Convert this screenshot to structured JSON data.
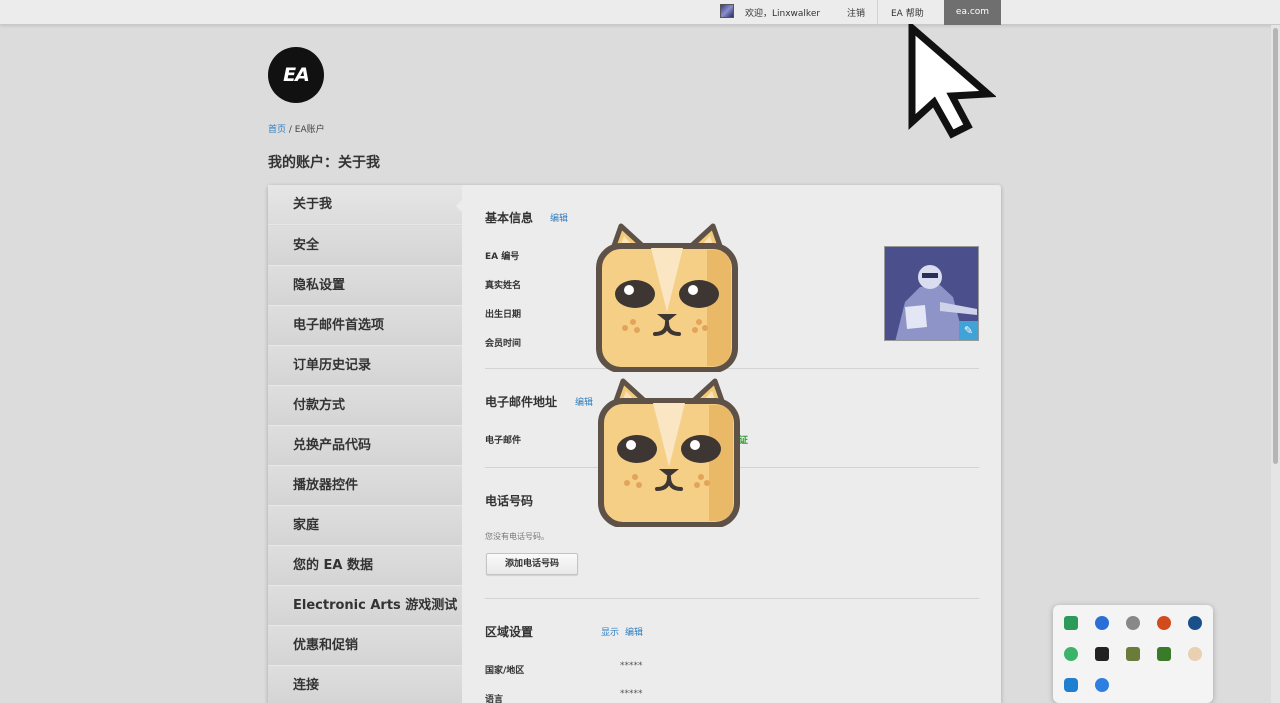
{
  "topbar": {
    "welcome": "欢迎，Linxwalker",
    "logout": "注销",
    "help": "EA 帮助",
    "site": "ea.com"
  },
  "logo_text": "EA",
  "breadcrumb": {
    "home": "首页",
    "separator": " / ",
    "current": "EA账户"
  },
  "page_title": "我的账户：关于我",
  "sidenav": {
    "items": [
      {
        "label": "关于我"
      },
      {
        "label": "安全"
      },
      {
        "label": "隐私设置"
      },
      {
        "label": "电子邮件首选项"
      },
      {
        "label": "订单历史记录"
      },
      {
        "label": "付款方式"
      },
      {
        "label": "兑换产品代码"
      },
      {
        "label": "播放器控件"
      },
      {
        "label": "家庭"
      },
      {
        "label": "您的 EA 数据"
      },
      {
        "label": "Electronic Arts 游戏测试"
      },
      {
        "label": "优惠和促销"
      },
      {
        "label": "连接"
      }
    ]
  },
  "basic_info": {
    "title": "基本信息",
    "edit": "编辑",
    "fields": [
      "EA 编号",
      "真实姓名",
      "出生日期",
      "会员时间"
    ]
  },
  "email": {
    "title": "电子邮件地址",
    "edit": "编辑",
    "label": "电子邮件",
    "status": "证"
  },
  "phone": {
    "title": "电话号码",
    "none_text": "您没有电话号码。",
    "add_button": "添加电话号码"
  },
  "region": {
    "title": "区域设置",
    "show": "显示",
    "edit": "编辑",
    "fields": [
      {
        "label": "国家/地区",
        "value": "*****"
      },
      {
        "label": "语言",
        "value": "*****"
      }
    ]
  },
  "icons": {
    "pencil": "pencil-icon",
    "sticker": "cat-face-sticker",
    "cursor": "mouse-pointer-icon"
  },
  "colors": {
    "link": "#2e7ec0",
    "eacom_bg": "#6f6f6f",
    "verified": "#2a9d2a",
    "pencil_bg": "#3fa3d8"
  }
}
